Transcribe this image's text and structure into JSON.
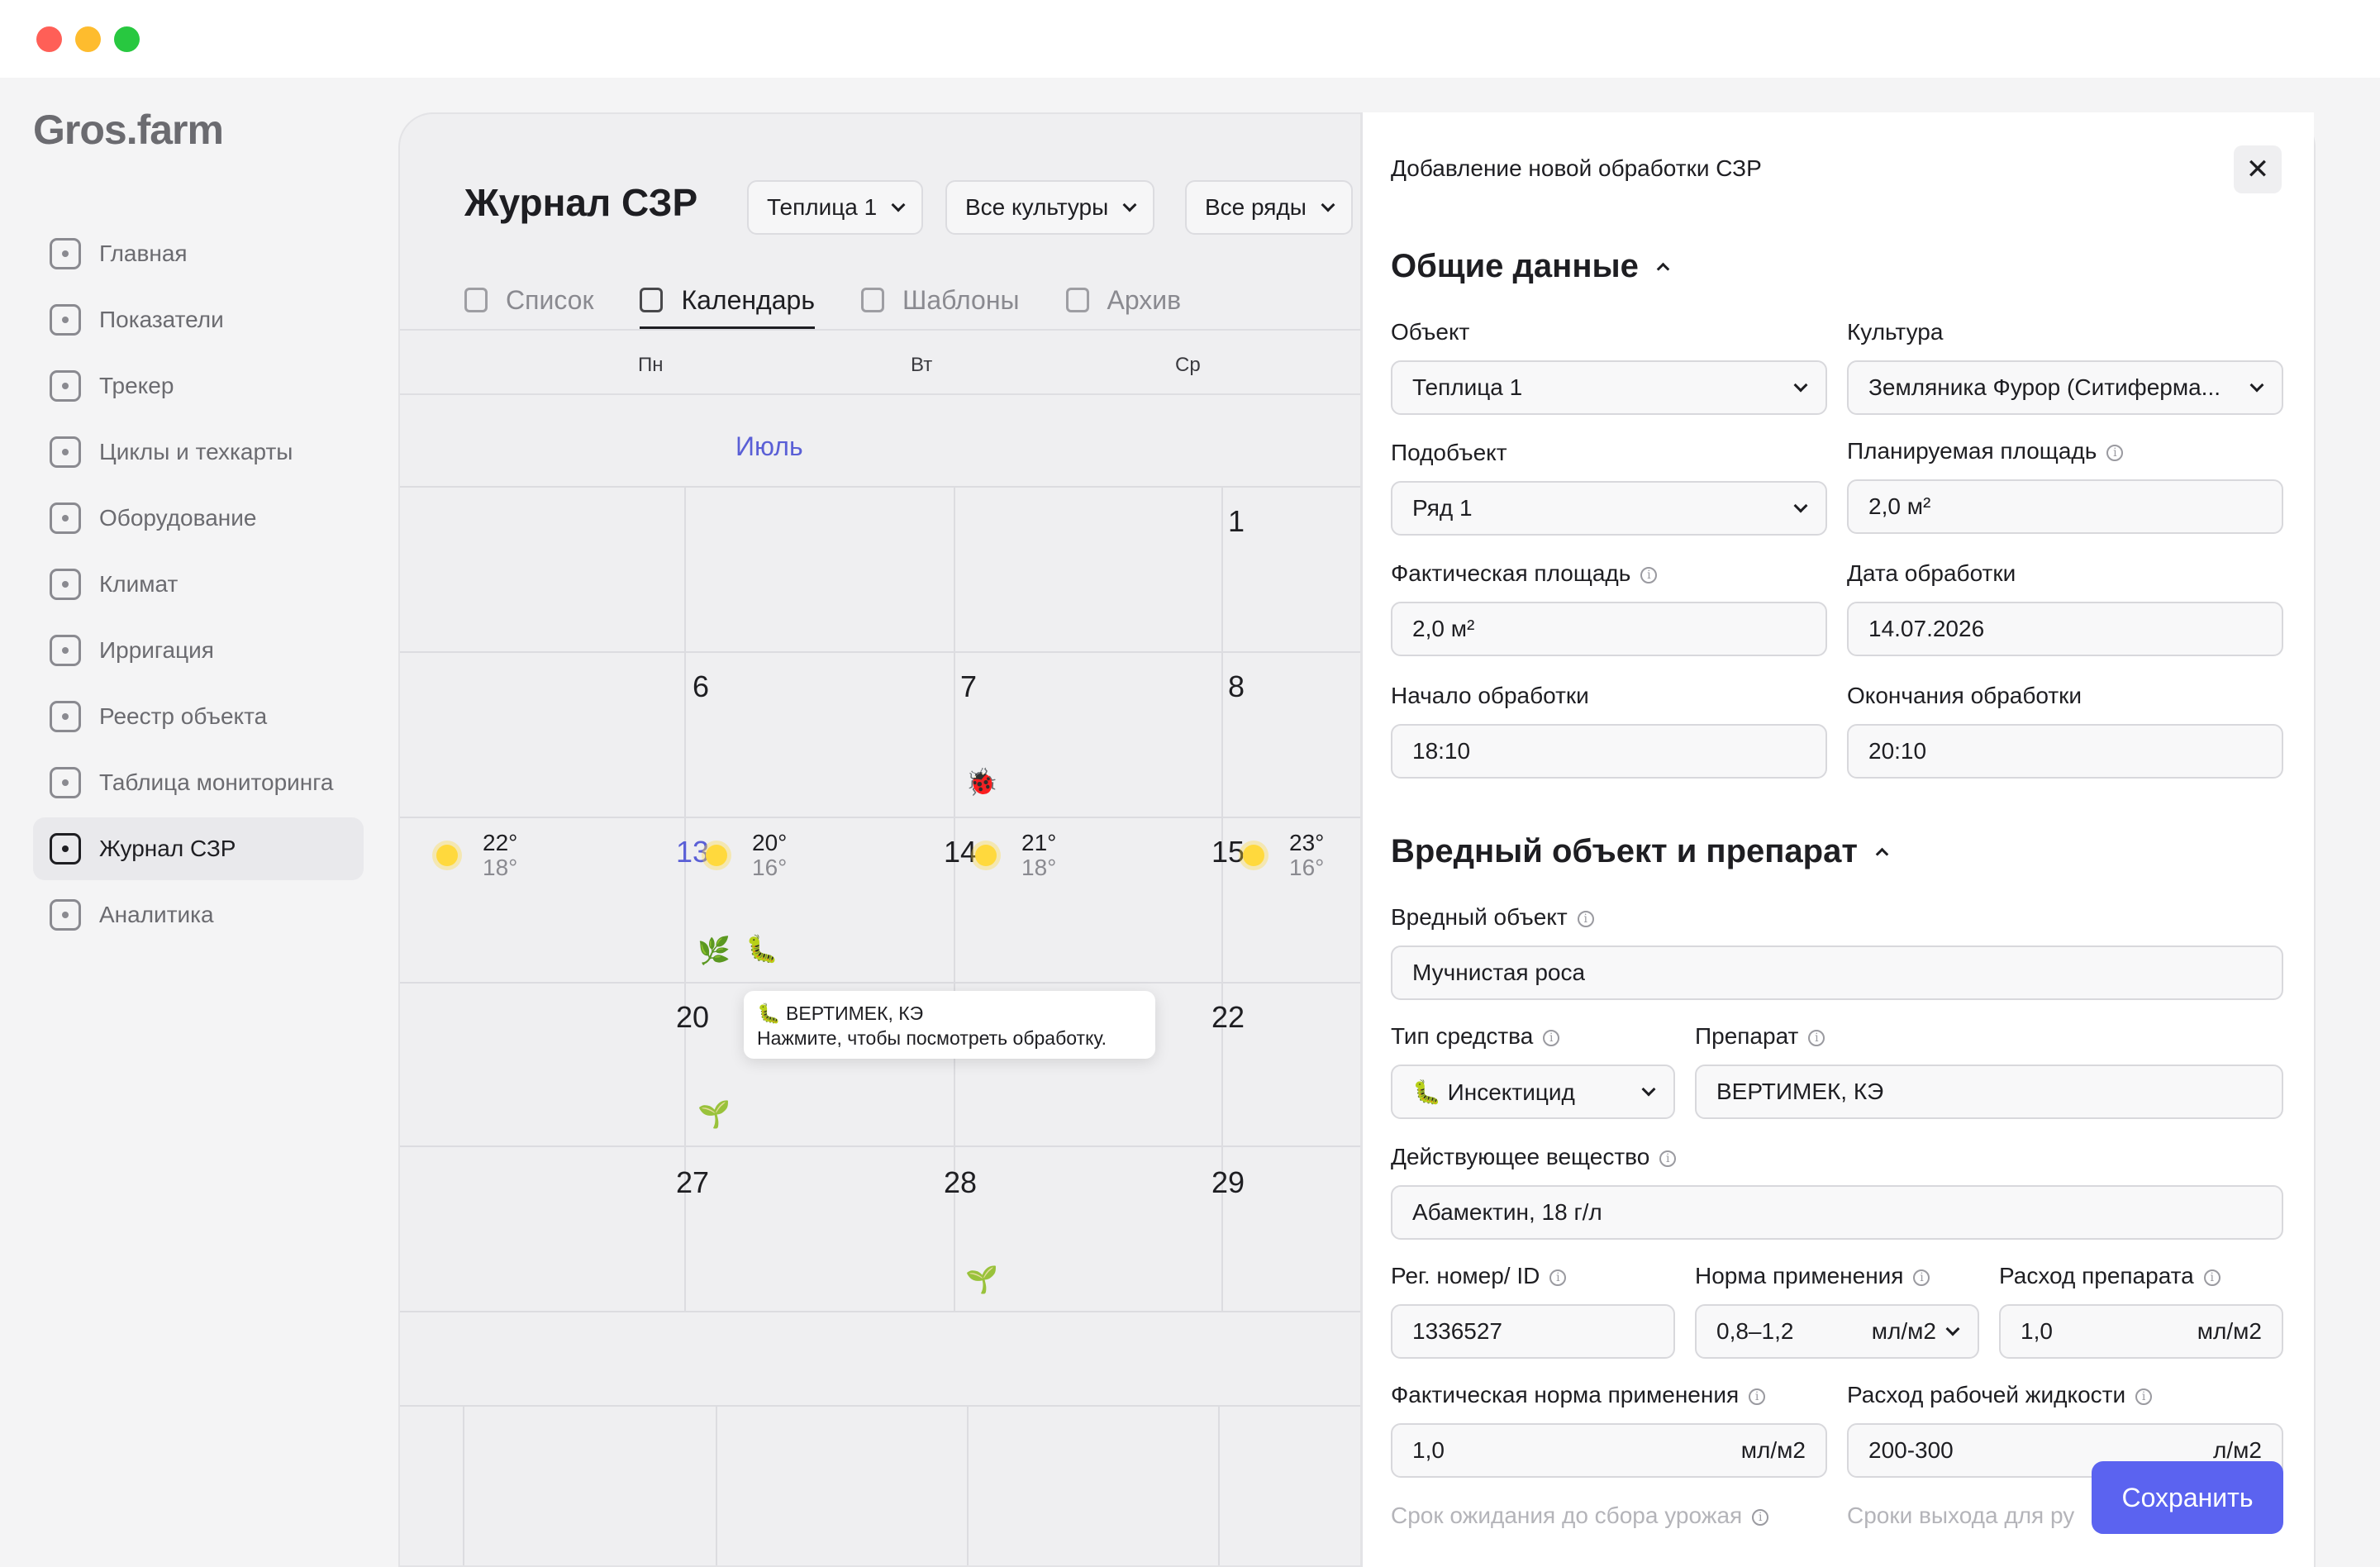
{
  "app": {
    "logo": "Gros.farm"
  },
  "sidebar": {
    "items": [
      {
        "label": "Главная",
        "icon": "home-icon"
      },
      {
        "label": "Показатели",
        "icon": "metrics-icon"
      },
      {
        "label": "Трекер",
        "icon": "tracker-icon"
      },
      {
        "label": "Циклы и техкарты",
        "icon": "document-icon"
      },
      {
        "label": "Оборудование",
        "icon": "equipment-icon"
      },
      {
        "label": "Климат",
        "icon": "thermometer-icon"
      },
      {
        "label": "Ирригация",
        "icon": "irrigation-icon"
      },
      {
        "label": "Реестр объекта",
        "icon": "grid-icon"
      },
      {
        "label": "Таблица мониторинга",
        "icon": "table-icon"
      },
      {
        "label": "Журнал СЗР",
        "icon": "journal-icon",
        "active": true
      },
      {
        "label": "Аналитика",
        "icon": "analytics-icon"
      }
    ]
  },
  "journal": {
    "title": "Журнал СЗР",
    "filters": {
      "greenhouse": "Теплица 1",
      "crops": "Все культуры",
      "rows": "Все ряды"
    },
    "tabs": [
      {
        "label": "Список",
        "icon": "list-icon"
      },
      {
        "label": "Календарь",
        "icon": "calendar-icon",
        "active": true
      },
      {
        "label": "Шаблоны",
        "icon": "templates-icon"
      },
      {
        "label": "Архив",
        "icon": "archive-icon"
      }
    ],
    "weekdays": [
      "Пн",
      "Вт",
      "Ср"
    ],
    "month": "Июль",
    "days": {
      "d1": "1",
      "d6": "6",
      "d7": "7",
      "d8": "8",
      "d13": "13",
      "d14": "14",
      "d15": "15",
      "d20": "20",
      "d22": "22",
      "d27": "27",
      "d28": "28",
      "d29": "29"
    },
    "weather": {
      "d13": {
        "hi": "22°",
        "lo": "18°"
      },
      "d14": {
        "hi": "20°",
        "lo": "16°"
      },
      "d15": {
        "hi": "21°",
        "lo": "18°"
      },
      "d16": {
        "hi": "23°",
        "lo": "16°"
      }
    },
    "icons": {
      "ladybug": "🐞",
      "herb": "🌿",
      "caterpillar": "🐛",
      "sprout": "🌱"
    },
    "tooltip": {
      "title": "🐛 ВЕРТИМЕК, КЭ",
      "hint": "Нажмите, чтобы посмотреть обработку."
    }
  },
  "drawer": {
    "title": "Добавление новой обработки СЗР",
    "general": {
      "title": "Общие данные",
      "object_label": "Объект",
      "object_value": "Теплица 1",
      "culture_label": "Культура",
      "culture_value": "Земляника Фурор (Ситиферма...",
      "subobject_label": "Подобъект",
      "subobject_value": "Ряд 1",
      "planned_area_label": "Планируемая площадь",
      "planned_area_value": "2,0 м²",
      "actual_area_label": "Фактическая площадь",
      "actual_area_value": "2,0 м²",
      "date_label": "Дата обработки",
      "date_value": "14.07.2026",
      "start_label": "Начало обработки",
      "start_value": "18:10",
      "end_label": "Окончания обработки",
      "end_value": "20:10"
    },
    "pest": {
      "title": "Вредный объект и препарат",
      "pest_label": "Вредный объект",
      "pest_value": "Мучнистая роса",
      "type_label": "Тип средства",
      "type_value": "🐛 Инсектицид",
      "product_label": "Препарат",
      "product_value": "ВЕРТИМЕК, КЭ",
      "ingredient_label": "Действующее вещество",
      "ingredient_value": "Абамектин, 18 г/л",
      "reg_label": "Рег. номер/ ID",
      "reg_value": "1336527",
      "rate_label": "Норма применения",
      "rate_value": "0,8–1,2",
      "rate_unit": "мл/м2",
      "consumption_label": "Расход препарата",
      "consumption_value": "1,0",
      "consumption_unit": "мл/м2",
      "actual_rate_label": "Фактическая норма применения",
      "actual_rate_value": "1,0",
      "actual_rate_unit": "мл/м2",
      "liquid_label": "Расход рабочей жидкости",
      "liquid_value": "200-300",
      "liquid_unit": "л/м2",
      "wait_label": "Срок ожидания до сбора урожая",
      "exit_label": "Сроки выхода для ру"
    },
    "save_label": "Сохранить",
    "close_symbol": "✕",
    "info_symbol": "i"
  }
}
